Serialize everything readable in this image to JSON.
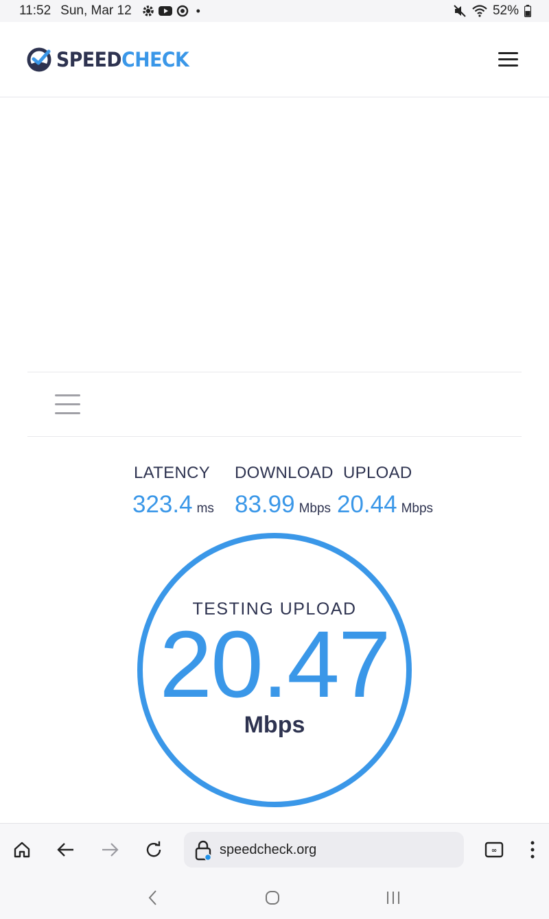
{
  "status_bar": {
    "time": "11:52",
    "date": "Sun, Mar 12",
    "dot": "•",
    "battery": "52%",
    "icons": [
      "settings-icon",
      "youtube-icon",
      "sync-icon",
      "mute-icon",
      "wifi-icon",
      "battery-icon"
    ]
  },
  "header": {
    "logo_part1": "SPEED",
    "logo_part2": "CHECK",
    "menu_icon": "hamburger-menu-icon"
  },
  "metrics": {
    "latency": {
      "label": "LATENCY",
      "value": "323.4",
      "unit": "ms"
    },
    "download": {
      "label": "DOWNLOAD",
      "value": "83.99",
      "unit": "Mbps"
    },
    "upload": {
      "label": "UPLOAD",
      "value": "20.44",
      "unit": "Mbps"
    }
  },
  "gauge": {
    "status": "TESTING UPLOAD",
    "value": "20.47",
    "unit": "Mbps"
  },
  "browser": {
    "url": "speedcheck.org",
    "icons": [
      "home-icon",
      "back-arrow-icon",
      "forward-arrow-icon",
      "reload-icon",
      "lock-icon",
      "tabs-icon",
      "more-options-icon"
    ]
  },
  "system_nav": {
    "icons": [
      "back-icon",
      "home-circle-icon",
      "recent-apps-icon"
    ]
  },
  "colors": {
    "accent": "#3a97e8",
    "text_dark": "#2e3350"
  }
}
